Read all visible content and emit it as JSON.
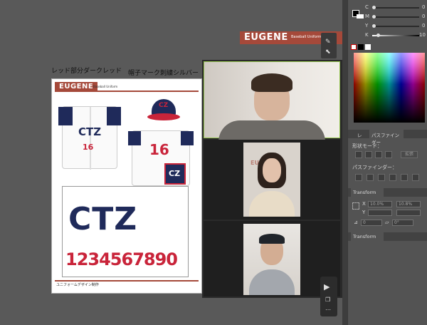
{
  "board": {
    "annotation_left": "レッド部分ダークレッド",
    "annotation_right": "帽子マーク刺繍シルバー",
    "brand": "EUGENE",
    "brand_sub": "Baseball Uniform",
    "jersey_text": "CTZ",
    "jersey_number": "16",
    "back_number": "16",
    "cap_logo": "CZ",
    "logo_large": "CTZ",
    "numbers": "1234567890",
    "footer": "ユニフォームデザイン制作"
  },
  "banner": {
    "brand": "EUGENE",
    "sub": "Baseball Uniform"
  },
  "video_wall": {
    "overlay_text": "EUGENE"
  },
  "color_panel": {
    "channels": [
      {
        "key": "C",
        "value": "0"
      },
      {
        "key": "M",
        "value": "0"
      },
      {
        "key": "Y",
        "value": "0"
      },
      {
        "key": "K",
        "value": "10"
      }
    ]
  },
  "pathfinder": {
    "tab_label": "パスファインダー",
    "tab_prefix": "レ",
    "shape_mode_label": "形状モード：",
    "expand_label": "拡張",
    "pathfinder_label": "パスファインダー："
  },
  "transform": {
    "title": "Transform",
    "x_label": "X",
    "x_value": "10.0%",
    "y_label": "Y",
    "y_value": "10.8%",
    "angle_value": "0",
    "shear_value": "0°",
    "title2": "Transform"
  },
  "colors": {
    "accent": "#a5493a",
    "navy": "#1f2a5a",
    "red": "#c9243a"
  }
}
